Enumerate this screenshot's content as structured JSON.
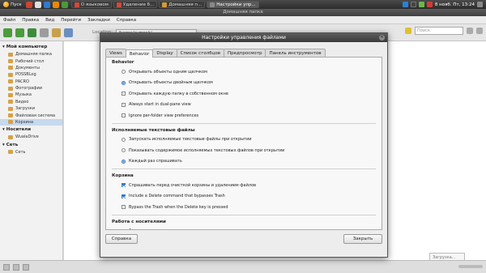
{
  "taskbar": {
    "start_label": "Пуск",
    "tasks": [
      {
        "label": "О языковом",
        "color": "#d04a3a",
        "active": false
      },
      {
        "label": "Удаление б...",
        "color": "#d04a3a",
        "active": false
      },
      {
        "label": "Домашняя п...",
        "color": "#d09a3a",
        "active": false
      },
      {
        "label": "Настройки упр...",
        "color": "#888",
        "active": true
      }
    ],
    "clock": "8 нояб. Пт, 13:24"
  },
  "file_manager": {
    "title": "Домашняя папка",
    "menu": [
      "Файл",
      "Правка",
      "Вид",
      "Перейти",
      "Закладки",
      "Справка"
    ],
    "location_label": "Location:",
    "location_value": "/home/symrak/",
    "search_placeholder": "Поиск",
    "sidebar": {
      "sections": [
        {
          "title": "Мой компьютер",
          "items": [
            {
              "label": "Домашняя папка",
              "selected": false
            },
            {
              "label": "Рабочий стол",
              "selected": false
            },
            {
              "label": "Документы",
              "selected": false
            },
            {
              "label": "POSSBLog",
              "selected": false
            },
            {
              "label": "PACRO",
              "selected": false
            },
            {
              "label": "Фотографии",
              "selected": false
            },
            {
              "label": "Музыка",
              "selected": false
            },
            {
              "label": "Видео",
              "selected": false
            },
            {
              "label": "Загрузки",
              "selected": false
            },
            {
              "label": "Файловая система",
              "selected": false
            },
            {
              "label": "Корзина",
              "selected": true
            }
          ]
        },
        {
          "title": "Носители",
          "items": [
            {
              "label": "WualaDrive",
              "selected": false
            }
          ]
        },
        {
          "title": "Сеть",
          "items": [
            {
              "label": "Сеть",
              "selected": false
            }
          ]
        }
      ]
    },
    "notification": "Загрузка..."
  },
  "dialog": {
    "title": "Настройки управления файлами",
    "tabs": [
      {
        "label": "Views",
        "active": false
      },
      {
        "label": "Behavior",
        "active": true
      },
      {
        "label": "Display",
        "active": false
      },
      {
        "label": "Список столбцов",
        "active": false
      },
      {
        "label": "Предпросмотр",
        "active": false
      },
      {
        "label": "Панель инструментов",
        "active": false
      }
    ],
    "sections": [
      {
        "title": "Behavior",
        "options": [
          {
            "type": "radio",
            "checked": false,
            "label": "Открывать объекты одним щелчком"
          },
          {
            "type": "radio",
            "checked": true,
            "label": "Открывать объекты двойным щелчком"
          },
          {
            "type": "check",
            "checked": false,
            "label": "Открывать каждую папку в собственном окне"
          },
          {
            "type": "check",
            "checked": false,
            "label": "Always start in dual-pane view"
          },
          {
            "type": "check",
            "checked": false,
            "label": "Ignore per-folder view preferences"
          }
        ]
      },
      {
        "title": "Исполняемые текстовые файлы",
        "options": [
          {
            "type": "radio",
            "checked": false,
            "label": "Запускать исполняемые текстовые файлы при открытии"
          },
          {
            "type": "radio",
            "checked": false,
            "label": "Показывать содержимое исполняемых текстовых файлов при открытии"
          },
          {
            "type": "radio",
            "checked": true,
            "label": "Каждый раз спрашивать"
          }
        ]
      },
      {
        "title": "Корзина",
        "options": [
          {
            "type": "check",
            "checked": true,
            "label": "Спрашивать перед очисткой корзины и удалением файлов"
          },
          {
            "type": "check",
            "checked": true,
            "label": "Include a Delete command that bypasses Trash"
          },
          {
            "type": "check",
            "checked": false,
            "label": "Bypass the Trash when the Delete key is pressed"
          }
        ]
      },
      {
        "title": "Работа с носителями",
        "options": [
          {
            "type": "check",
            "checked": true,
            "label": "Автоматически присоединять переносные носители при подключении и запуске"
          }
        ]
      }
    ],
    "help_button": "Справка",
    "close_button": "Закрыть"
  }
}
